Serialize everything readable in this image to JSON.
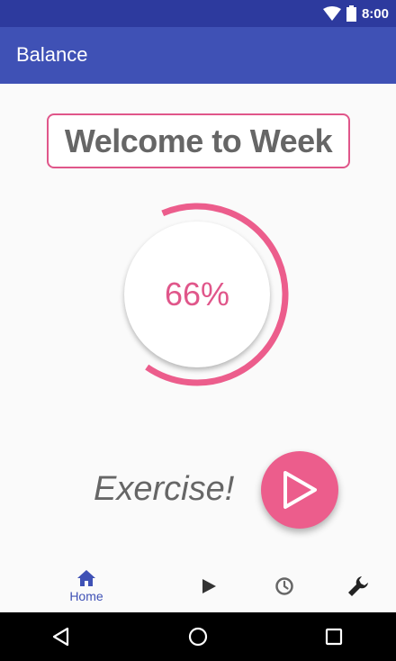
{
  "status_bar": {
    "time": "8:00",
    "background": "#2d3a9e"
  },
  "app_bar": {
    "title": "Balance",
    "background": "#3f51b5"
  },
  "welcome": {
    "text": "Welcome to Week",
    "border_color": "#e0568a"
  },
  "progress": {
    "label": "66%",
    "value": 66,
    "color": "#e0568a"
  },
  "exercise": {
    "label": "Exercise!",
    "play_icon": "play-icon",
    "button_color": "#ec5d8c"
  },
  "bottom_nav": {
    "items": [
      {
        "id": "home",
        "label": "Home",
        "icon": "home-icon",
        "active": true
      },
      {
        "id": "play",
        "label": "",
        "icon": "play-icon",
        "active": false
      },
      {
        "id": "history",
        "label": "",
        "icon": "clock-icon",
        "active": false
      },
      {
        "id": "settings",
        "label": "",
        "icon": "wrench-icon",
        "active": false
      }
    ],
    "active_color": "#3f51b5"
  },
  "system_nav": {
    "icons": [
      "back-icon",
      "home-circle-icon",
      "recents-icon"
    ]
  }
}
